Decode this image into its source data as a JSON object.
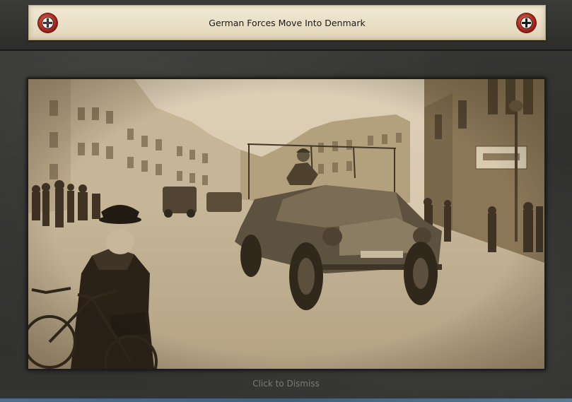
{
  "event": {
    "title": "German Forces Move Into Denmark",
    "dismiss_label": "Click to Dismiss",
    "left_emblem_icon": "iron-cross-roundel-icon",
    "right_emblem_icon": "iron-cross-roundel-icon",
    "photo": "armored-car-in-town-street"
  },
  "colors": {
    "frame": "#2b2b29",
    "title_plate": "#ece2c9",
    "title_text": "#1e1a14",
    "emblem_red": "#b3261c",
    "dismiss_text": "#7c7a74"
  }
}
